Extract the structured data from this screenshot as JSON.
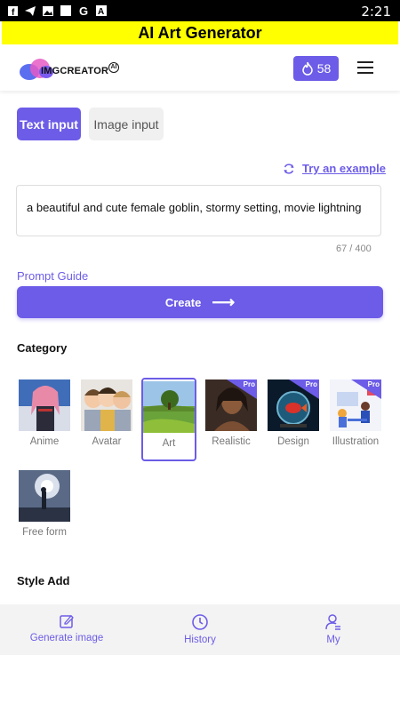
{
  "status_bar": {
    "time": "2:21",
    "icons": [
      "facebook-icon",
      "telegram-icon",
      "image-icon",
      "square-icon",
      "google-icon",
      "a-icon"
    ]
  },
  "app": {
    "title": "AI Art Generator"
  },
  "header": {
    "logo_text": "IMGCREATOR",
    "logo_badge": "AI",
    "credits": "58"
  },
  "tabs": [
    {
      "label": "Text input",
      "active": true
    },
    {
      "label": "Image input",
      "active": false
    }
  ],
  "prompt": {
    "try_example_label": "Try an example",
    "value": "a beautiful and cute female goblin, stormy setting, movie lightning",
    "counter": "67 / 400",
    "guide_label": "Prompt Guide"
  },
  "create_label": "Create",
  "category": {
    "title": "Category",
    "items": [
      {
        "label": "Anime",
        "pro": false,
        "selected": false
      },
      {
        "label": "Avatar",
        "pro": false,
        "selected": false
      },
      {
        "label": "Art",
        "pro": false,
        "selected": true
      },
      {
        "label": "Realistic",
        "pro": true,
        "selected": false
      },
      {
        "label": "Design",
        "pro": true,
        "selected": false
      },
      {
        "label": "Illustration",
        "pro": true,
        "selected": false
      },
      {
        "label": "Free form",
        "pro": false,
        "selected": false
      }
    ],
    "pro_badge": "Pro"
  },
  "style_add_title": "Style Add",
  "bottom_nav": [
    {
      "label": "Generate image",
      "icon": "edit-icon"
    },
    {
      "label": "History",
      "icon": "clock-icon"
    },
    {
      "label": "My",
      "icon": "user-icon"
    }
  ],
  "colors": {
    "accent": "#6c5ce7",
    "title_bar": "#ffff00"
  }
}
